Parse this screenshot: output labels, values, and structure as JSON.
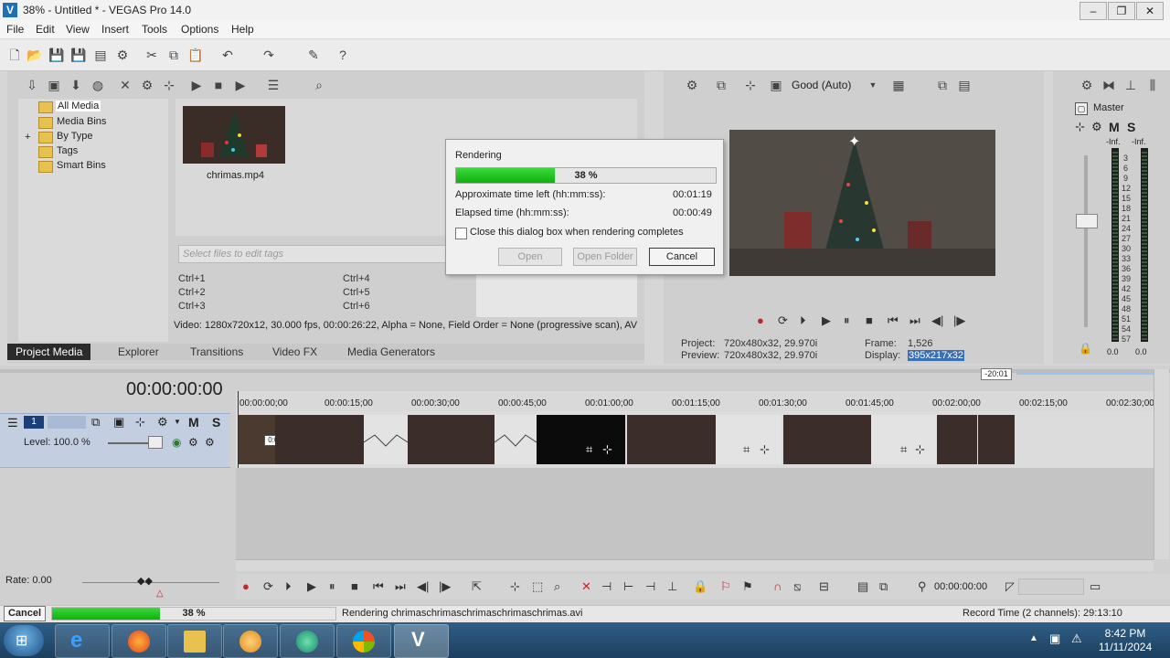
{
  "window": {
    "title": "38% - Untitled * - VEGAS Pro 14.0",
    "app_icon": "vegas-logo-icon"
  },
  "menu": [
    "File",
    "Edit",
    "View",
    "Insert",
    "Tools",
    "Options",
    "Help"
  ],
  "explorer": {
    "tree": [
      "All Media",
      "Media Bins",
      "By Type",
      "Tags",
      "Smart Bins"
    ],
    "tree_expander": "+",
    "media_file": "chrimas.mp4",
    "tag_placeholder": "Select files to edit tags",
    "shortcuts": [
      "Ctrl+1",
      "Ctrl+2",
      "Ctrl+3",
      "Ctrl+4",
      "Ctrl+5",
      "Ctrl+6"
    ],
    "info": "Video: 1280x720x12, 30.000 fps, 00:00:26:22, Alpha = None, Field Order = None (progressive scan), AV",
    "tabs": [
      "Project Media",
      "Explorer",
      "Transitions",
      "Video FX",
      "Media Generators"
    ]
  },
  "preview": {
    "quality": "Good (Auto)",
    "project_label": "Project:",
    "project_value": "720x480x32, 29.970i",
    "preview_label": "Preview:",
    "preview_value": "720x480x32, 29.970i",
    "frame_label": "Frame:",
    "frame_value": "1,526",
    "display_label": "Display:",
    "display_value": "395x217x32"
  },
  "mixer": {
    "title": "Master",
    "m_label": "M",
    "s_label": "S",
    "inf_left": "-Inf.",
    "inf_right": "-Inf.",
    "scale": [
      "3",
      "6",
      "9",
      "12",
      "15",
      "18",
      "21",
      "24",
      "27",
      "30",
      "33",
      "36",
      "39",
      "42",
      "45",
      "48",
      "51",
      "54",
      "57"
    ],
    "level_left": "0.0",
    "level_right": "0.0"
  },
  "dialog": {
    "title": "Rendering",
    "progress": 38,
    "progress_text": "38 %",
    "time_left_label": "Approximate time left (hh:mm:ss):",
    "time_left_value": "00:01:19",
    "elapsed_label": "Elapsed time (hh:mm:ss):",
    "elapsed_value": "00:00:49",
    "checkbox_label": "Close this dialog box when rendering completes",
    "open_button": "Open",
    "open_folder_button": "Open Folder",
    "cancel_button": "Cancel"
  },
  "timeline": {
    "timecode": "00:00:00:00",
    "zoom_marker": "-20:01",
    "track_number": "1",
    "track_m": "M",
    "track_s": "S",
    "level": "Level: 100.0 %",
    "clip_fade": "0:00",
    "ticks": [
      "00:00:00;00",
      "00:00:15;00",
      "00:00:30;00",
      "00:00:45;00",
      "00:01:00;00",
      "00:01:15;00",
      "00:01:30;00",
      "00:01:45;00",
      "00:02:00;00",
      "00:02:15;00",
      "00:02:30;00"
    ],
    "rate": "Rate: 0.00",
    "transport_timecode": "00:00:00:00"
  },
  "status": {
    "cancel_button": "Cancel",
    "progress": 38,
    "progress_text": "38 %",
    "message": "Rendering chrimaschrimaschrimaschrimaschrimas.avi",
    "record_time": "Record Time (2 channels): 29:13:10"
  },
  "taskbar": {
    "time": "8:42 PM",
    "date": "11/11/2024"
  },
  "colors": {
    "progress_green": "#1fc01f",
    "track_header": "#c3cfe0",
    "taskbar": "#24496b"
  }
}
